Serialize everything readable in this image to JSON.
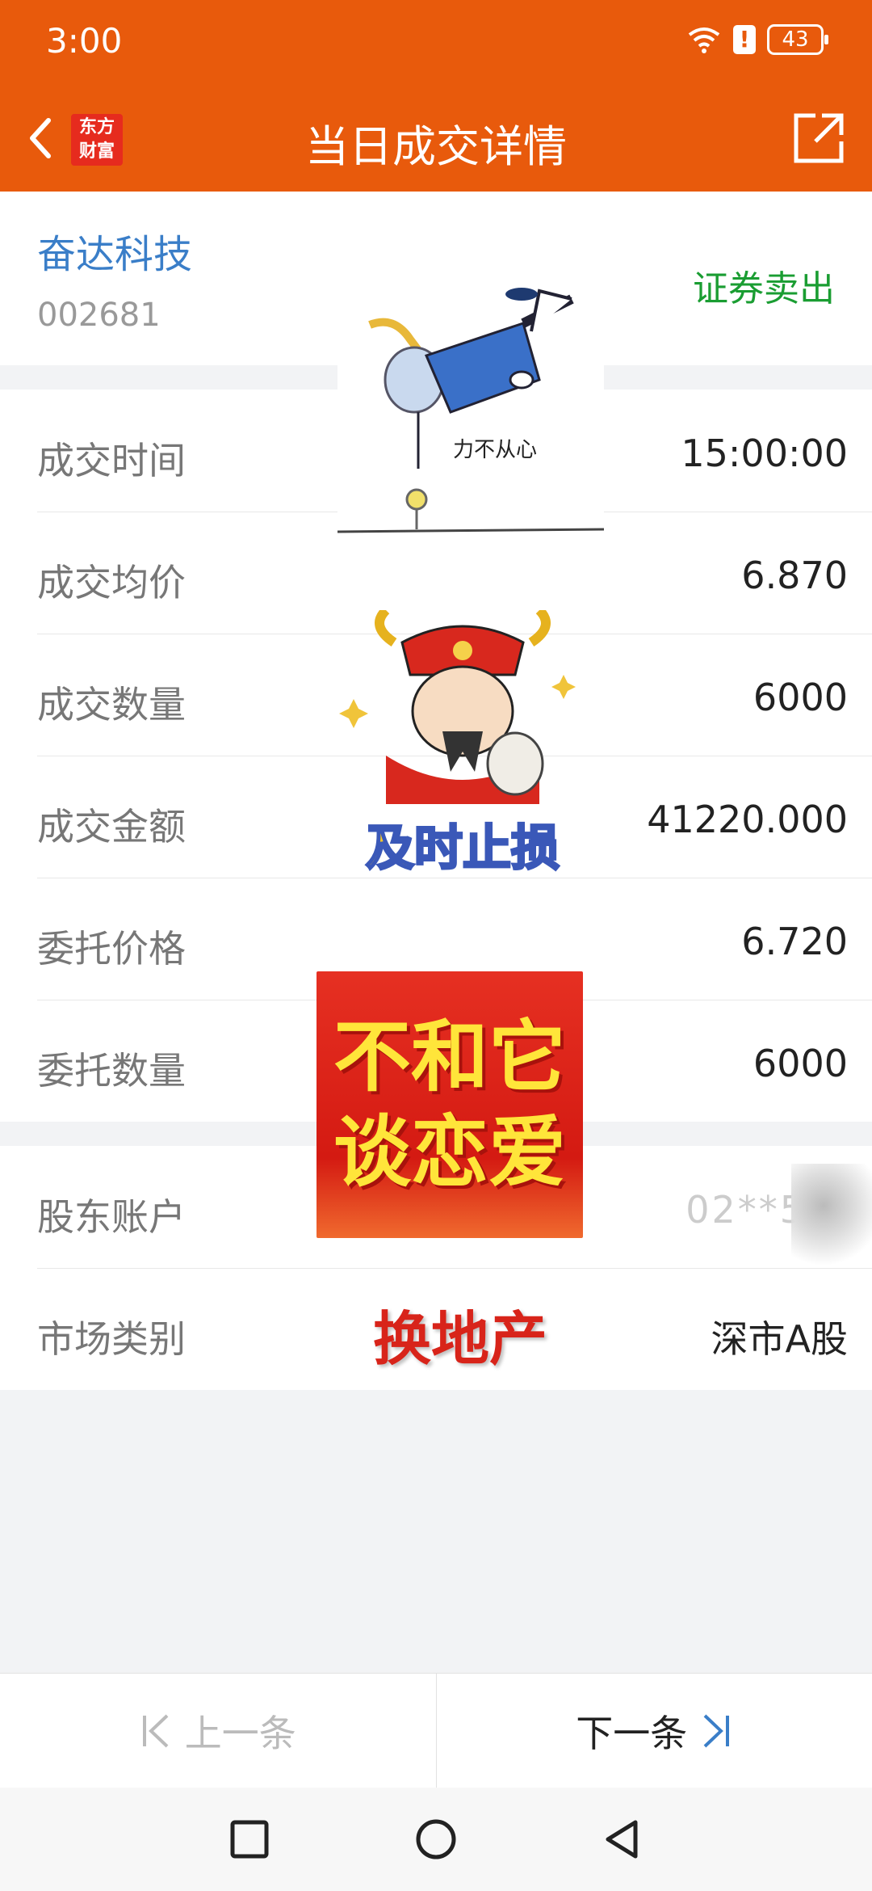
{
  "status": {
    "time": "3:00",
    "battery": "43"
  },
  "nav": {
    "logo_line1": "东方",
    "logo_line2": "财富",
    "title": "当日成交详情"
  },
  "stock": {
    "name": "奋达科技",
    "code": "002681",
    "trade_type": "证券卖出"
  },
  "details": [
    {
      "label": "成交时间",
      "value": "15:00:00"
    },
    {
      "label": "成交均价",
      "value": "6.870"
    },
    {
      "label": "成交数量",
      "value": "6000"
    },
    {
      "label": "成交金额",
      "value": "41220.000"
    },
    {
      "label": "委托价格",
      "value": "6.720"
    },
    {
      "label": "委托数量",
      "value": "6000"
    }
  ],
  "account": [
    {
      "label": "股东账户",
      "value": "02**5**"
    },
    {
      "label": "市场类别",
      "value": "深市A股"
    }
  ],
  "stickers": {
    "s1_caption": "力不从心",
    "s2_caption": "及时止损",
    "s3_line1": "不和它",
    "s3_line2": "谈恋爱",
    "s4_text": "换地产"
  },
  "bottom": {
    "prev_label": "上一条",
    "next_label": "下一条"
  },
  "colors": {
    "brand": "#e85a0c",
    "link": "#3a7ec8",
    "sell": "#1a9d32"
  }
}
